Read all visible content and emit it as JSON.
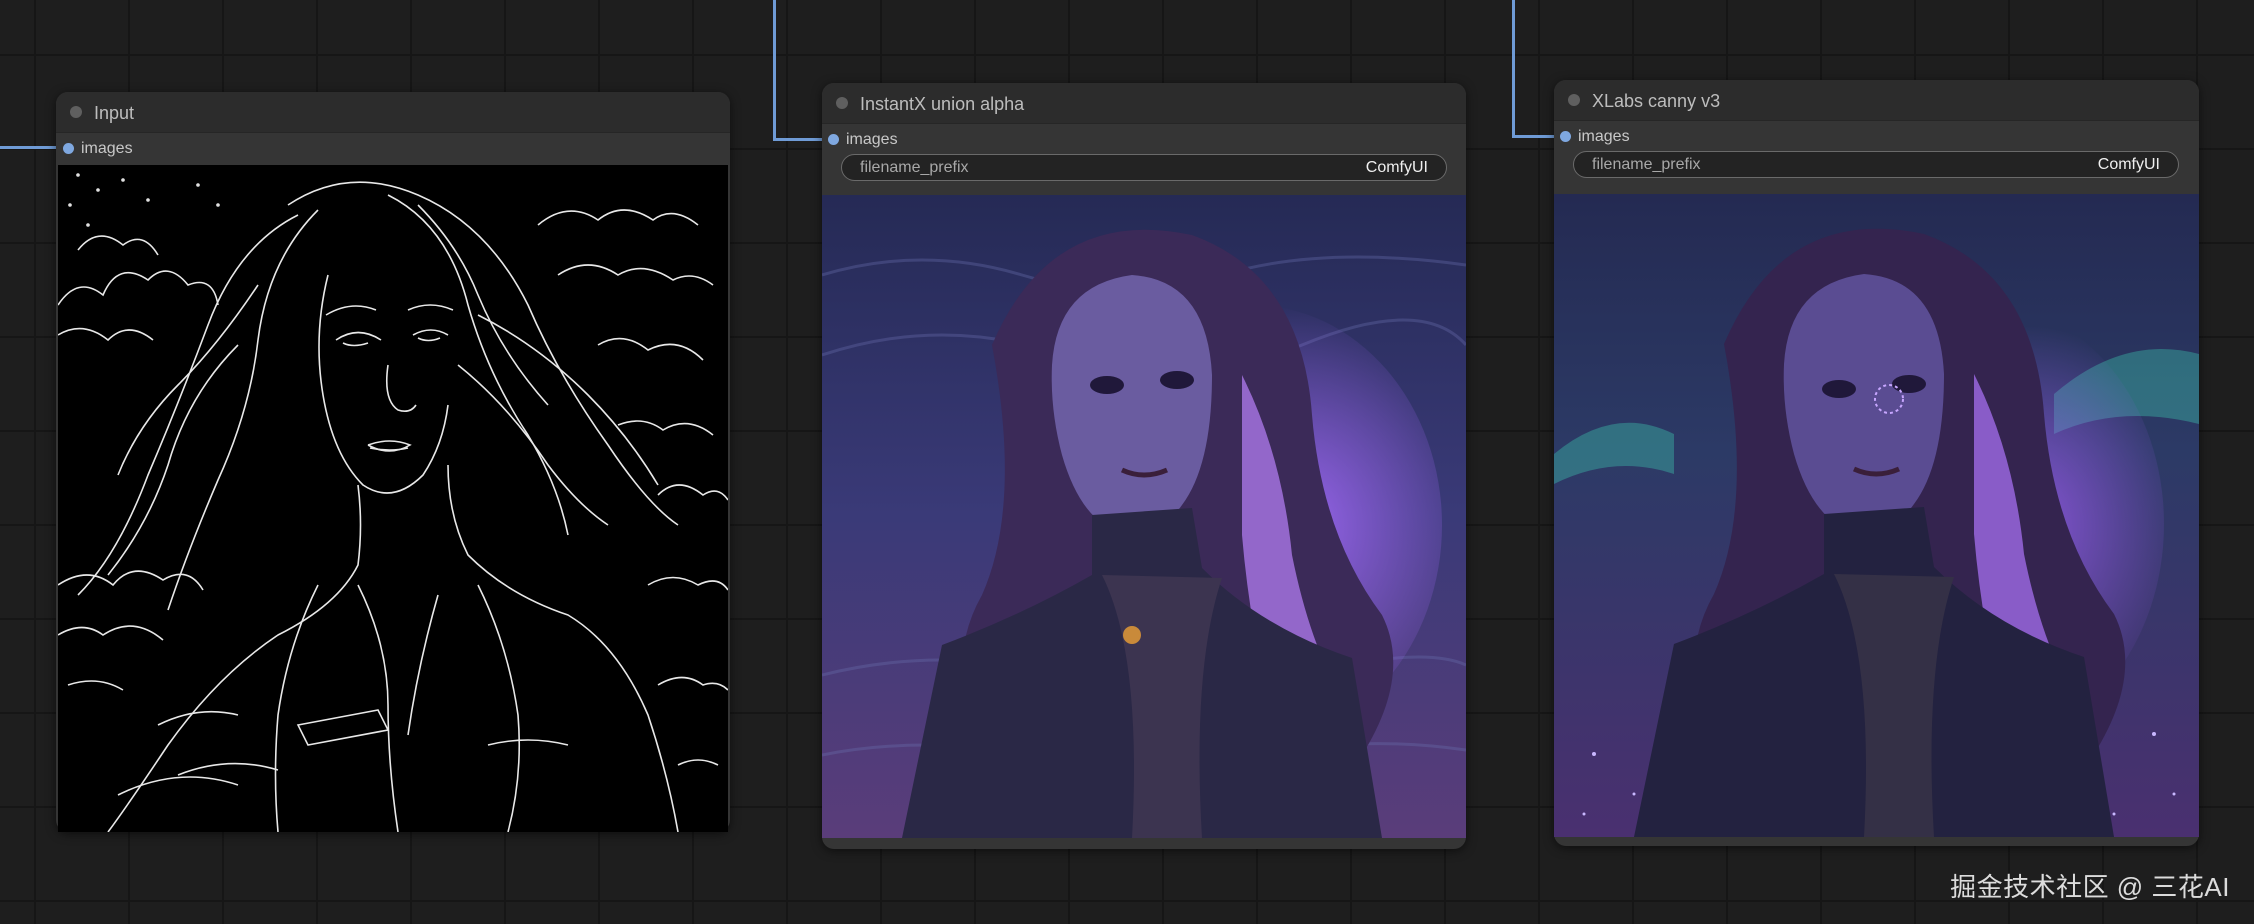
{
  "nodes": [
    {
      "title": "Input",
      "input_slot": "images"
    },
    {
      "title": "InstantX union alpha",
      "input_slot": "images",
      "widget": {
        "name": "filename_prefix",
        "value": "ComfyUI"
      }
    },
    {
      "title": "XLabs canny v3",
      "input_slot": "images",
      "widget": {
        "name": "filename_prefix",
        "value": "ComfyUI"
      }
    }
  ],
  "watermark": "掘金技术社区 @ 三花AI",
  "colors": {
    "canvas": "#1e1e1e",
    "node": "#353535",
    "wire": "#6f9bd6",
    "slot": "#7fa8e0"
  }
}
